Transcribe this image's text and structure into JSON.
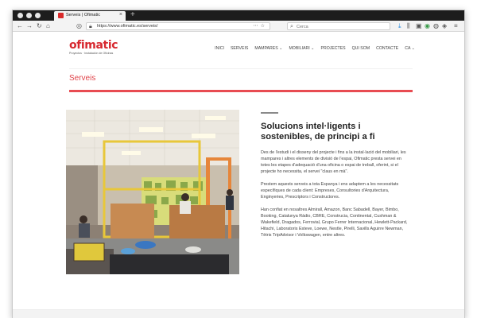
{
  "browser": {
    "tab_title": "Serveis | Ofimatic",
    "tab_close": "×",
    "new_tab": "+",
    "url": "https://www.ofimatic.es/serveis/",
    "search_placeholder": "Cerca",
    "icons": {
      "back": "back-arrow-icon",
      "forward": "forward-arrow-icon",
      "reload": "reload-icon",
      "home": "home-icon",
      "lock": "lock-icon"
    }
  },
  "site": {
    "logo_text": "ofimatic",
    "tagline": "Proyectos · Instalación de Oficinas",
    "brand_color": "#d7282f",
    "nav": [
      {
        "label": "INICI"
      },
      {
        "label": "SERVEIS"
      },
      {
        "label": "MAMPARES ⌄"
      },
      {
        "label": "MOBILIARI ⌄"
      },
      {
        "label": "PROJECTES"
      },
      {
        "label": "QUI SOM"
      },
      {
        "label": "CONTACTE"
      },
      {
        "label": "CA ⌄"
      }
    ]
  },
  "banner": {
    "title": "Serveis",
    "accent_color": "#e84c52"
  },
  "content": {
    "heading": "Solucions intel·ligents i sostenibles, de principi a fi",
    "paragraphs": [
      "Des de l'estudi i el disseny del projecte i fins a la instal·lació del mobiliari, les mampares i altres elements de divisió de l'espai, Ofimatic presta servei en totes les etapes d'adequació d'una oficina o espai de treball, oferint, si el projecte ho necessita, el servei \"claus en mà\".",
      "Prestem aquests serveis a tota Espanya i ens adaptem a les necessitats específiques de cada client: Empreses, Consultories d'Arquitectura, Enginyeries, Prescriptors i Constructores.",
      "Han confiat en nosaltres Almirall, Amazon, Banc Sabadell, Bayer, Bimbo, Booking, Catalunya Ràdio, CBRE, Construcia, Continental, Cushman & Wakefield, Dragados, Ferrovial, Grupo Ferrer Internacional, Hewlett-Packard, Hitachi, Laboratoris Esteve, Loewe, Nestle, Pirelli, Savills Aguirre Newman, Tètris TripAdvisor i Volkswagen, entre altres."
    ]
  }
}
